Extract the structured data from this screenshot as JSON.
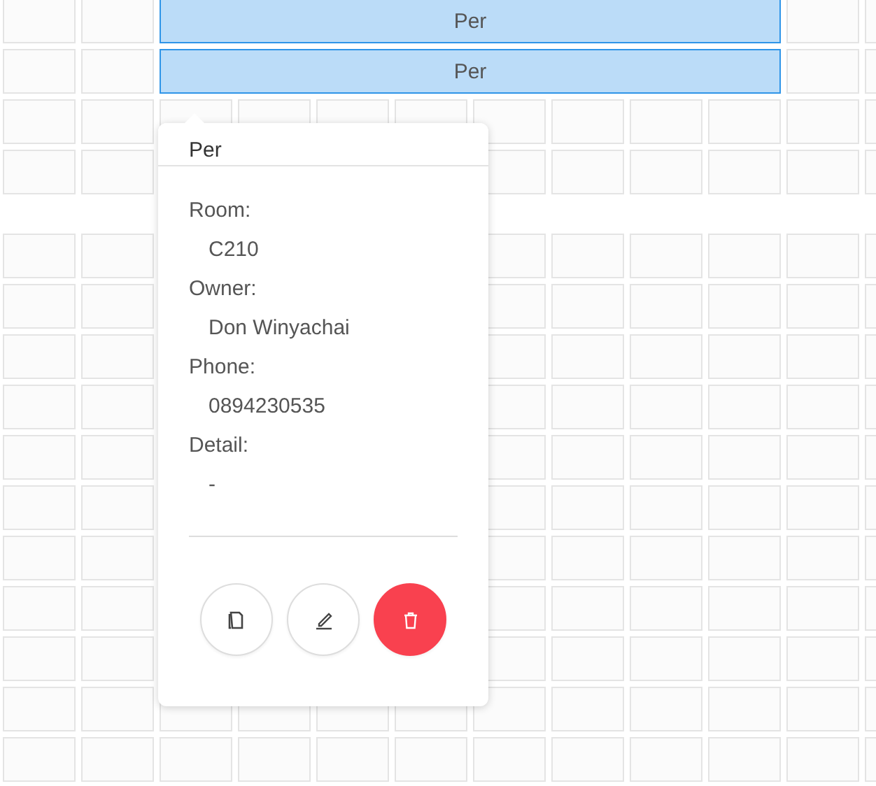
{
  "bookings": [
    {
      "label": "Per"
    },
    {
      "label": "Per"
    }
  ],
  "popover": {
    "title": "Per",
    "fields": [
      {
        "label": "Room:",
        "value": "C210"
      },
      {
        "label": "Owner:",
        "value": "Don Winyachai"
      },
      {
        "label": "Phone:",
        "value": "0894230535"
      },
      {
        "label": "Detail:",
        "value": "-"
      }
    ],
    "actions": [
      {
        "kind": "copy"
      },
      {
        "kind": "edit"
      },
      {
        "kind": "delete"
      }
    ]
  }
}
